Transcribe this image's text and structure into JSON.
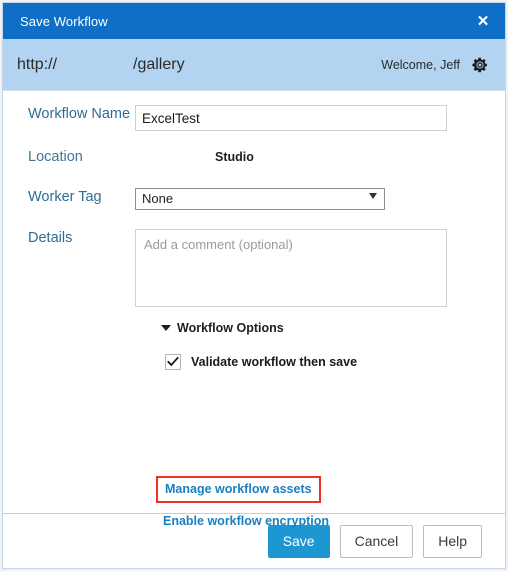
{
  "dialog": {
    "title": "Save Workflow",
    "close_label": "✕"
  },
  "appbar": {
    "url": "http://",
    "path": "/gallery",
    "welcome": "Welcome, Jeff",
    "gear_icon": "gear-icon"
  },
  "form": {
    "workflow_name_label": "Workflow Name",
    "workflow_name_value": "ExcelTest",
    "workflow_name_placeholder": "",
    "location_label": "Location",
    "location_value": "Studio",
    "worker_tag_label": "Worker Tag",
    "worker_tag_value": "None",
    "worker_tag_options": [
      "None"
    ],
    "details_label": "Details",
    "details_value": "",
    "details_placeholder": "Add a comment (optional)"
  },
  "options": {
    "header": "Workflow Options",
    "expanded": true,
    "validate_label": "Validate workflow then save",
    "validate_checked": true,
    "manage_assets_link": "Manage workflow assets",
    "encryption_link": "Enable workflow encryption"
  },
  "footer": {
    "save_label": "Save",
    "cancel_label": "Cancel",
    "help_label": "Help"
  },
  "colors": {
    "titlebar": "#0f6fc6",
    "appbar": "#b3d4f0",
    "label": "#2d6d93",
    "link": "#1a7fc1",
    "primary_button": "#1c97d1",
    "highlight_box": "#ee3124"
  }
}
